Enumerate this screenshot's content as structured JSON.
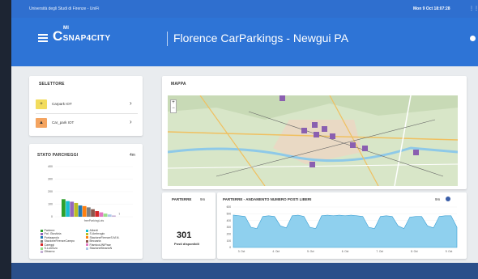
{
  "topbar": {
    "url": "Università degli Studi di Firenze - UniFi",
    "clock": "Mon 9 Oct 18:07:28"
  },
  "header": {
    "logo_main": "SNAP",
    "logo_num": "4",
    "logo_end": "CITY",
    "logo_sup": "MI",
    "title": "Florence CarParkings - Newgui PA"
  },
  "selettore": {
    "title": "SELETTORE",
    "items": [
      {
        "label": "Carpark IOT",
        "color": "#f2dc5d",
        "glyph": "+"
      },
      {
        "label": "Car_park IOT",
        "color": "#f4a460",
        "glyph": "▲"
      }
    ]
  },
  "stato": {
    "title": "STATO PARCHEGGI",
    "interval": "4m",
    "legend": [
      {
        "label": "Parterre",
        "color": "#2ca02c"
      },
      {
        "label": "Alberti",
        "color": "#17becf"
      },
      {
        "label": "Pal. Giustizia",
        "color": "#9467bd"
      },
      {
        "label": "S.Ambrogio",
        "color": "#bcbd22"
      },
      {
        "label": "Portaaprolo",
        "color": "#1f77b4"
      },
      {
        "label": "StazioneFirenzeS.M.N.",
        "color": "#ff7f0e"
      },
      {
        "label": "StazioneFirenzeCampo",
        "color": "#7f7f7f"
      },
      {
        "label": "Beccaria",
        "color": "#8c564b"
      },
      {
        "label": "Careggi",
        "color": "#d62728"
      },
      {
        "label": "FiamicoUNIPaar",
        "color": "#e377c2"
      },
      {
        "label": "S.Lorenzo",
        "color": "#98df8a"
      },
      {
        "label": "StazioneBinarioN",
        "color": "#aec7e8"
      },
      {
        "label": "Oltrarno",
        "color": "#c5b0d5"
      }
    ]
  },
  "mappa": {
    "title": "MAPPA",
    "zoom_in": "+",
    "zoom_out": "−"
  },
  "parterre": {
    "title": "PARTERRE",
    "interval": "9m",
    "value": "301",
    "label": "Posti disponibili"
  },
  "trend": {
    "title": "PARTERRE - ANDAMENTO NUMERO POSTI LIBERI",
    "interval": "9m"
  },
  "chart_data": [
    {
      "type": "bar",
      "title": "STATO PARCHEGGI",
      "xlabel": "freeParkingLots",
      "ylim": [
        0,
        400
      ],
      "yticks": [
        0,
        100,
        200,
        300,
        400
      ],
      "values": [
        140,
        125,
        120,
        110,
        90,
        85,
        75,
        60,
        45,
        35,
        25,
        18,
        10
      ],
      "colors": [
        "#2ca02c",
        "#17becf",
        "#9467bd",
        "#bcbd22",
        "#1f77b4",
        "#ff7f0e",
        "#7f7f7f",
        "#8c564b",
        "#d62728",
        "#e377c2",
        "#98df8a",
        "#aec7e8",
        "#c5b0d5"
      ],
      "annotation": "7"
    },
    {
      "type": "area",
      "title": "PARTERRE - ANDAMENTO NUMERO POSTI LIBERI",
      "ylim": [
        0,
        600
      ],
      "yticks": [
        0,
        100,
        200,
        300,
        400,
        500,
        600
      ],
      "x_labels": [
        "3. Oct",
        "4. Oct",
        "5. Oct",
        "6. Oct",
        "7. Oct",
        "8. Oct",
        "9. Oct"
      ],
      "values": [
        480,
        470,
        460,
        300,
        280,
        460,
        470,
        460,
        320,
        290,
        470,
        480,
        460,
        300,
        280,
        470,
        480,
        470,
        480,
        470,
        480,
        470,
        460,
        300,
        280,
        460,
        470,
        460,
        320,
        280,
        450,
        460,
        460,
        320,
        290,
        460,
        470,
        470,
        300
      ]
    }
  ]
}
